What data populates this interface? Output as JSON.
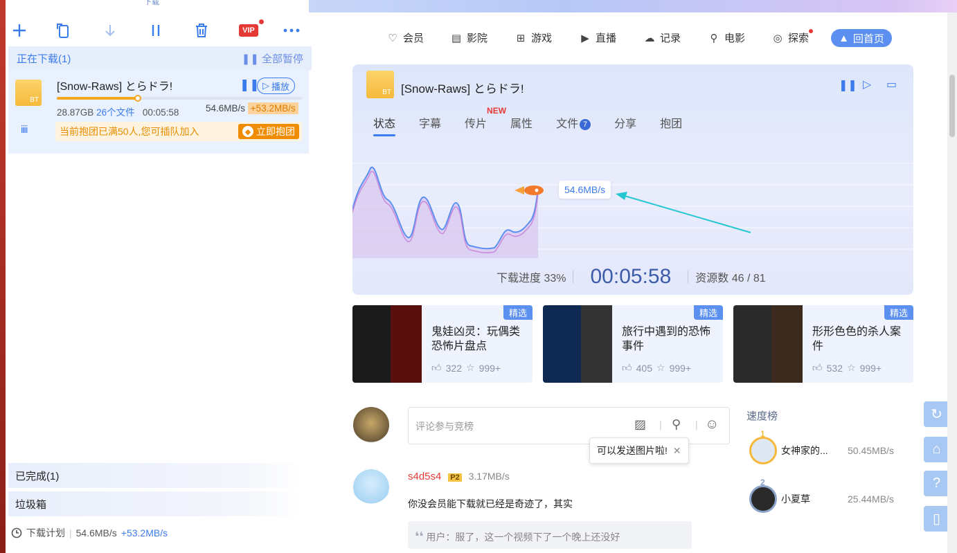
{
  "toolbar": {
    "download_label": "下载",
    "vip_label": "VIP"
  },
  "downloading": {
    "header": "正在下载(1)",
    "pause_all": "全部暂停",
    "task": {
      "title": "[Snow-Raws] とらドラ!",
      "folder_tag": "BT",
      "play_label": "播放",
      "progress": 0.33,
      "size": "28.87GB",
      "files": "26个文件",
      "time": "00:05:58",
      "speed": "54.6MB/s",
      "accel": "+53.2MB/s",
      "group_msg": "当前抱团已满50人,您可插队加入",
      "group_btn": "立即抱团"
    }
  },
  "completed": "已完成(1)",
  "trash": "垃圾箱",
  "footer": {
    "plan": "下载计划",
    "speed": "54.6MB/s",
    "accel": "+53.2MB/s"
  },
  "nav": [
    {
      "label": "会员",
      "icon": "member-icon"
    },
    {
      "label": "影院",
      "icon": "cinema-icon"
    },
    {
      "label": "游戏",
      "icon": "game-icon"
    },
    {
      "label": "直播",
      "icon": "live-icon"
    },
    {
      "label": "记录",
      "icon": "cloud-icon"
    },
    {
      "label": "电影",
      "icon": "movie-icon"
    },
    {
      "label": "探索",
      "icon": "explore-icon"
    }
  ],
  "home_label": "回首页",
  "panel": {
    "title": "[Snow-Raws] とらドラ!",
    "folder_tag": "BT",
    "tabs": [
      "状态",
      "字幕",
      "传片",
      "属性",
      "文件",
      "分享",
      "抱团"
    ],
    "new_badge": "NEW",
    "files_badge": "7",
    "speed_label": "54.6MB/s",
    "progress_label": "下载进度 33%",
    "elapsed": "00:05:58",
    "sources": "资源数 46 / 81"
  },
  "cards": [
    {
      "badge": "精选",
      "title": "鬼娃凶灵：玩偶类恐怖片盘点",
      "likes": "322",
      "stars": "999+"
    },
    {
      "badge": "精选",
      "title": "旅行中遇到的恐怖事件",
      "likes": "405",
      "stars": "999+"
    },
    {
      "badge": "精选",
      "title": "形形色色的杀人案件",
      "likes": "532",
      "stars": "999+"
    }
  ],
  "comment": {
    "placeholder": "评论参与竞榜",
    "tip": "可以发送图片啦!",
    "user": "s4d5s4",
    "level": "P2",
    "user_speed": "3.17MB/s",
    "text": "你没会员能下载就已经是奇迹了，其实",
    "quote": "用户：服了，这一个视频下了一个晚上还没好"
  },
  "ranking": {
    "title": "速度榜",
    "items": [
      {
        "rank": "1",
        "name": "女神家的...",
        "speed": "50.45MB/s"
      },
      {
        "rank": "2",
        "name": "小夏草",
        "speed": "25.44MB/s"
      }
    ]
  },
  "colors": {
    "accent": "#3b7bec",
    "orange": "#f08c00",
    "panel_bg": "#e4eafb"
  }
}
